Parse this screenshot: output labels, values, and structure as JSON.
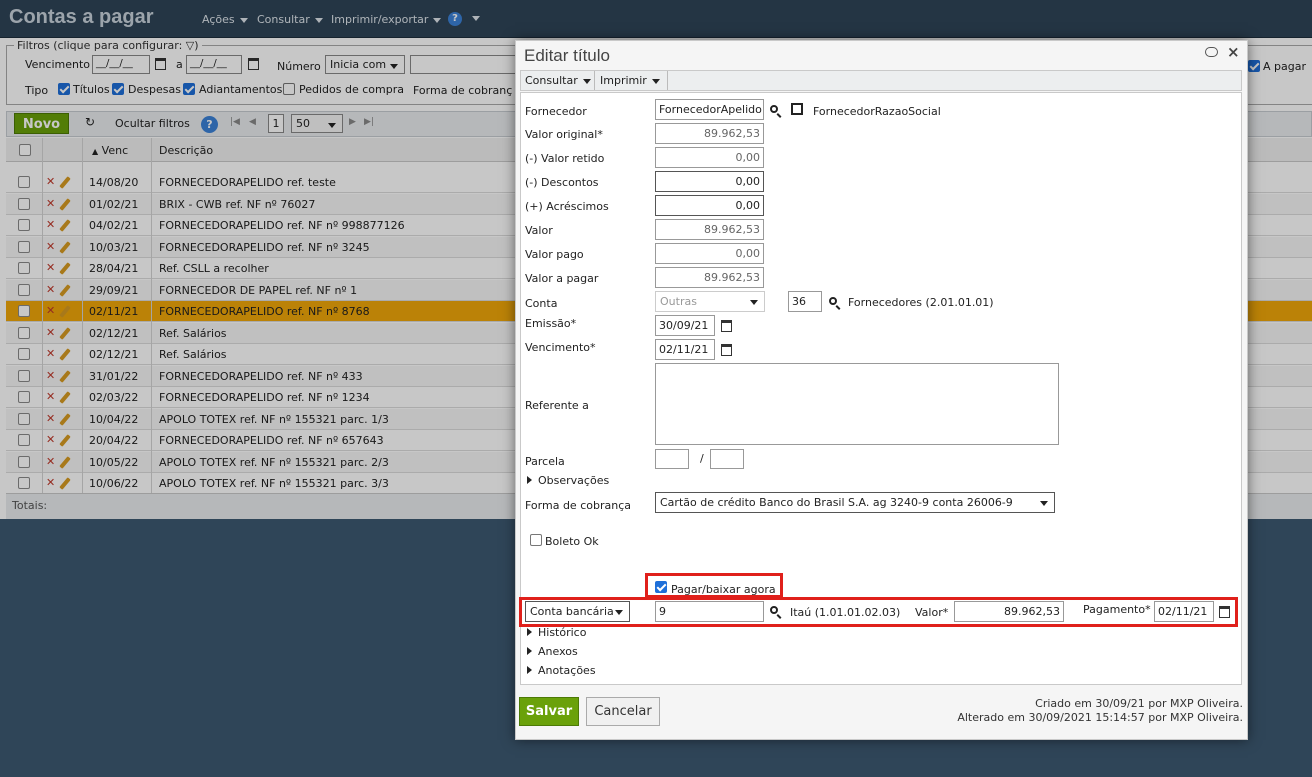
{
  "app": {
    "title": "Contas a pagar",
    "menus": [
      "Ações",
      "Consultar",
      "Imprimir/exportar"
    ]
  },
  "filters": {
    "legend": "Filtros (clique para configurar:",
    "vencimento_label": "Vencimento",
    "date_placeholder": "__/__/__",
    "a_label": "a",
    "numero_label": "Número",
    "numero_mode": "Inicia com",
    "tipo_label": "Tipo",
    "tipos": [
      {
        "label": "Títulos",
        "checked": true
      },
      {
        "label": "Despesas",
        "checked": true
      },
      {
        "label": "Adiantamentos",
        "checked": true
      },
      {
        "label": "Pedidos de compra",
        "checked": false
      }
    ],
    "forma_cobranca_label": "Forma de cobranç",
    "a_pagar_label": "A pagar"
  },
  "list_toolbar": {
    "novo": "Novo",
    "ocultar_filtros": "Ocultar filtros",
    "page": "1",
    "page_size": "50"
  },
  "table": {
    "headers": {
      "venc": "Venc",
      "descricao": "Descrição"
    },
    "rows": [
      {
        "venc": "14/08/20",
        "desc": "FORNECEDORAPELIDO ref. teste",
        "selected": false
      },
      {
        "venc": "01/02/21",
        "desc": "BRIX - CWB ref. NF nº 76027",
        "selected": false
      },
      {
        "venc": "04/02/21",
        "desc": "FORNECEDORAPELIDO ref. NF nº 998877126",
        "selected": false
      },
      {
        "venc": "10/03/21",
        "desc": "FORNECEDORAPELIDO ref. NF nº 3245",
        "selected": false
      },
      {
        "venc": "28/04/21",
        "desc": "Ref. CSLL a recolher",
        "selected": false
      },
      {
        "venc": "29/09/21",
        "desc": "FORNECEDOR DE PAPEL ref. NF nº 1",
        "selected": false
      },
      {
        "venc": "02/11/21",
        "desc": "FORNECEDORAPELIDO ref. NF nº 8768",
        "selected": true
      },
      {
        "venc": "02/12/21",
        "desc": "Ref. Salários",
        "selected": false
      },
      {
        "venc": "02/12/21",
        "desc": "Ref. Salários",
        "selected": false
      },
      {
        "venc": "31/01/22",
        "desc": "FORNECEDORAPELIDO ref. NF nº 433",
        "selected": false
      },
      {
        "venc": "02/03/22",
        "desc": "FORNECEDORAPELIDO ref. NF nº 1234",
        "selected": false
      },
      {
        "venc": "10/04/22",
        "desc": "APOLO TOTEX ref. NF nº 155321 parc. 1/3",
        "selected": false
      },
      {
        "venc": "20/04/22",
        "desc": "FORNECEDORAPELIDO ref. NF nº 657643",
        "selected": false
      },
      {
        "venc": "10/05/22",
        "desc": "APOLO TOTEX ref. NF nº 155321 parc. 2/3",
        "selected": false
      },
      {
        "venc": "10/06/22",
        "desc": "APOLO TOTEX ref. NF nº 155321 parc. 3/3",
        "selected": false
      }
    ],
    "totais_label": "Totais:"
  },
  "dialog": {
    "title": "Editar título",
    "menu": {
      "consultar": "Consultar",
      "imprimir": "Imprimir"
    },
    "labels": {
      "fornecedor": "Fornecedor",
      "valor_original": "Valor original*",
      "valor_retido": "(-) Valor retido",
      "descontos": "(-) Descontos",
      "acrescimos": "(+) Acréscimos",
      "valor": "Valor",
      "valor_pago": "Valor pago",
      "valor_a_pagar": "Valor a pagar",
      "conta": "Conta",
      "emissao": "Emissão*",
      "vencimento": "Vencimento*",
      "referente_a": "Referente a",
      "parcela": "Parcela",
      "parcela_sep": "/",
      "observacoes": "Observações",
      "forma_cobranca": "Forma de cobrança",
      "boleto_ok": "Boleto Ok",
      "pagar_baixar": "Pagar/baixar agora",
      "valor_req": "Valor*",
      "pagamento": "Pagamento*",
      "historico": "Histórico",
      "anexos": "Anexos",
      "anotacoes": "Anotações"
    },
    "values": {
      "fornecedor": "FornecedorApelido",
      "fornecedor_razao": "FornecedorRazaoSocial",
      "valor_original": "89.962,53",
      "valor_retido": "0,00",
      "descontos": "0,00",
      "acrescimos": "0,00",
      "valor": "89.962,53",
      "valor_pago": "0,00",
      "valor_a_pagar": "89.962,53",
      "conta_tipo": "Outras",
      "conta_codigo": "36",
      "conta_nome": "Fornecedores (2.01.01.01)",
      "emissao": "30/09/21",
      "vencimento": "02/11/21",
      "referente_a": "",
      "parcela_num": "",
      "parcela_total": "",
      "forma_cobranca": "Cartão de crédito Banco do Brasil S.A. ag 3240-9 conta 26006-9",
      "boleto_ok": false,
      "pagar_baixar": true,
      "conta_bancaria_tipo": "Conta bancária",
      "conta_bancaria_codigo": "9",
      "conta_bancaria_nome": "Itaú (1.01.01.02.03)",
      "valor_pagamento": "89.962,53",
      "data_pagamento": "02/11/21"
    },
    "buttons": {
      "salvar": "Salvar",
      "cancelar": "Cancelar"
    },
    "footer": {
      "criado": "Criado em 30/09/21 por MXP Oliveira.",
      "alterado": "Alterado em 30/09/2021 15:14:57 por MXP Oliveira."
    }
  },
  "colors": {
    "accent_green": "#6aa10a",
    "highlight_row": "#f0a70a",
    "header_bg": "#2f4558",
    "annotation_red": "#e0201b"
  }
}
